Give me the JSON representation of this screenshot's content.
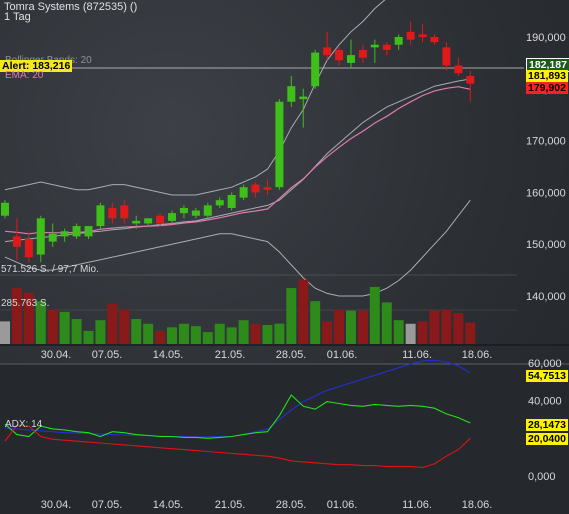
{
  "header": {
    "title": "Tomra Systems (872535) ()",
    "interval": "1 Tag",
    "bollinger_label": "Bollinger Bands: 20",
    "alert_label": "Alert: 183,216",
    "ema_label": "EMA: 20",
    "volume_max_label": "571.526 S. / 97,7 Mio.",
    "volume_mid_label": "285.763 S.",
    "adx_label": "ADX: 14"
  },
  "price_tags": {
    "last": "182,187",
    "upper": "181,893",
    "lower": "179,902"
  },
  "adx_tags": {
    "blue": "54,7513",
    "green": "28,1473",
    "red": "20,0400"
  },
  "colors": {
    "up": "#3fbf1a",
    "down": "#e01a1a",
    "volume_up": "#2f8a1c",
    "volume_down": "#8a1a1a",
    "volume_neutral": "#9a9a9a",
    "bollinger": "#a8adb3",
    "ema": "#e07ab0",
    "adx_blue": "#2330d8",
    "adx_green": "#22e01a",
    "adx_red": "#e01414",
    "alert_line": "#cfcfcf"
  },
  "chart_data": [
    {
      "type": "candlestick",
      "name": "price",
      "yticks": [
        140000,
        150000,
        160000,
        170000,
        180000,
        190000
      ],
      "ytick_labels": [
        "140,000",
        "150,000",
        "160,000",
        "170,000",
        "180,000",
        "190,000"
      ],
      "xtick_labels": [
        "30.04.",
        "07.05.",
        "14.05.",
        "21.05.",
        "28.05.",
        "01.06.",
        "11.06.",
        "18.06."
      ],
      "candles": [
        {
          "o": 155.5,
          "h": 158.5,
          "l": 155.0,
          "c": 158.0
        },
        {
          "o": 151.5,
          "h": 155.0,
          "l": 147.0,
          "c": 149.5
        },
        {
          "o": 151.0,
          "h": 152.5,
          "l": 146.5,
          "c": 147.5
        },
        {
          "o": 148.0,
          "h": 155.5,
          "l": 146.5,
          "c": 155.0
        },
        {
          "o": 150.5,
          "h": 154.0,
          "l": 149.5,
          "c": 152.0
        },
        {
          "o": 151.5,
          "h": 153.0,
          "l": 150.5,
          "c": 152.5
        },
        {
          "o": 151.5,
          "h": 154.0,
          "l": 151.0,
          "c": 153.5
        },
        {
          "o": 151.5,
          "h": 153.0,
          "l": 151.0,
          "c": 153.5
        },
        {
          "o": 153.5,
          "h": 158.0,
          "l": 153.0,
          "c": 157.5
        },
        {
          "o": 157.0,
          "h": 158.0,
          "l": 154.0,
          "c": 155.0
        },
        {
          "o": 157.5,
          "h": 158.5,
          "l": 154.0,
          "c": 155.0
        },
        {
          "o": 154.0,
          "h": 155.5,
          "l": 153.0,
          "c": 154.5
        },
        {
          "o": 154.0,
          "h": 155.0,
          "l": 153.5,
          "c": 155.0
        },
        {
          "o": 155.5,
          "h": 156.0,
          "l": 153.5,
          "c": 154.0
        },
        {
          "o": 154.5,
          "h": 156.5,
          "l": 154.0,
          "c": 156.0
        },
        {
          "o": 156.0,
          "h": 157.5,
          "l": 155.0,
          "c": 157.0
        },
        {
          "o": 155.5,
          "h": 157.0,
          "l": 155.0,
          "c": 156.5
        },
        {
          "o": 155.5,
          "h": 158.0,
          "l": 155.0,
          "c": 157.5
        },
        {
          "o": 157.5,
          "h": 159.0,
          "l": 157.0,
          "c": 158.5
        },
        {
          "o": 157.0,
          "h": 160.0,
          "l": 156.5,
          "c": 159.5
        },
        {
          "o": 159.0,
          "h": 161.5,
          "l": 158.5,
          "c": 161.0
        },
        {
          "o": 161.5,
          "h": 162.0,
          "l": 159.0,
          "c": 160.0
        },
        {
          "o": 161.0,
          "h": 162.5,
          "l": 159.5,
          "c": 160.5
        },
        {
          "o": 161.0,
          "h": 178.0,
          "l": 160.5,
          "c": 177.5
        },
        {
          "o": 177.5,
          "h": 182.5,
          "l": 176.5,
          "c": 180.5
        },
        {
          "o": 178.0,
          "h": 180.0,
          "l": 172.5,
          "c": 178.5
        },
        {
          "o": 180.5,
          "h": 187.5,
          "l": 180.0,
          "c": 187.0
        },
        {
          "o": 188.0,
          "h": 191.0,
          "l": 185.5,
          "c": 186.5
        },
        {
          "o": 187.5,
          "h": 188.0,
          "l": 184.5,
          "c": 185.5
        },
        {
          "o": 185.0,
          "h": 189.5,
          "l": 184.0,
          "c": 186.5
        },
        {
          "o": 187.5,
          "h": 188.5,
          "l": 185.0,
          "c": 186.0
        },
        {
          "o": 188.0,
          "h": 189.5,
          "l": 185.0,
          "c": 188.5
        },
        {
          "o": 188.5,
          "h": 189.0,
          "l": 186.5,
          "c": 187.5
        },
        {
          "o": 188.5,
          "h": 190.5,
          "l": 187.5,
          "c": 190.0
        },
        {
          "o": 191.0,
          "h": 193.0,
          "l": 188.5,
          "c": 189.5
        },
        {
          "o": 190.5,
          "h": 192.5,
          "l": 189.0,
          "c": 190.0
        },
        {
          "o": 190.0,
          "h": 190.5,
          "l": 188.5,
          "c": 189.0
        },
        {
          "o": 188.0,
          "h": 189.0,
          "l": 183.5,
          "c": 184.5
        },
        {
          "o": 184.5,
          "h": 186.0,
          "l": 182.5,
          "c": 183.0
        },
        {
          "o": 182.5,
          "h": 183.5,
          "l": 177.5,
          "c": 181.0
        }
      ],
      "bollinger_upper": [
        160.5,
        161.0,
        161.5,
        162.0,
        161.5,
        161.0,
        160.5,
        160.5,
        161.0,
        161.5,
        161.5,
        161.0,
        160.5,
        160.0,
        159.5,
        159.5,
        159.5,
        160.0,
        160.5,
        161.0,
        162.0,
        163.0,
        164.5,
        168.0,
        172.5,
        176.0,
        181.0,
        185.5,
        188.5,
        191.0,
        193.0,
        195.5,
        197.5,
        199.5,
        201.0,
        202.0,
        202.5,
        202.0,
        201.0,
        200.0
      ],
      "bollinger_mid": [
        150.5,
        150.8,
        151.0,
        151.3,
        151.5,
        151.8,
        152.0,
        152.3,
        152.5,
        152.8,
        153.0,
        153.3,
        153.5,
        153.8,
        154.0,
        154.3,
        154.5,
        155.0,
        155.5,
        156.0,
        156.5,
        157.0,
        157.5,
        158.5,
        160.5,
        162.5,
        165.0,
        167.5,
        169.5,
        171.5,
        173.5,
        175.0,
        176.5,
        177.5,
        178.5,
        179.5,
        180.5,
        181.0,
        181.5,
        181.9
      ],
      "bollinger_lower": [
        147.5,
        146.5,
        145.5,
        145.0,
        145.0,
        145.5,
        146.0,
        146.5,
        147.0,
        147.5,
        148.0,
        148.5,
        149.0,
        149.5,
        150.0,
        150.5,
        151.0,
        151.5,
        152.0,
        152.0,
        151.5,
        151.0,
        150.5,
        148.5,
        146.0,
        143.5,
        141.5,
        140.5,
        140.0,
        140.0,
        140.0,
        140.5,
        141.5,
        143.0,
        145.0,
        147.5,
        150.0,
        152.5,
        155.5,
        158.5
      ],
      "ema": [
        152.5,
        152.3,
        152.0,
        152.3,
        152.2,
        152.2,
        152.3,
        152.4,
        152.9,
        153.1,
        153.3,
        153.4,
        153.5,
        153.6,
        153.8,
        154.1,
        154.3,
        154.7,
        155.1,
        155.6,
        156.1,
        156.4,
        156.8,
        158.8,
        160.9,
        162.6,
        164.9,
        166.9,
        168.7,
        170.4,
        171.8,
        173.4,
        174.7,
        176.2,
        177.5,
        178.7,
        179.6,
        180.1,
        180.4,
        179.9
      ]
    },
    {
      "type": "bar",
      "name": "volume",
      "max_label": "571.526 S. / 97,7 Mio.",
      "values": [
        190000,
        470000,
        430000,
        360000,
        290000,
        270000,
        210000,
        110000,
        200000,
        340000,
        290000,
        210000,
        170000,
        110000,
        140000,
        170000,
        150000,
        100000,
        170000,
        140000,
        200000,
        170000,
        160000,
        171526,
        470000,
        540000,
        360000,
        190000,
        290000,
        280000,
        280000,
        480000,
        350000,
        200000,
        170000,
        190000,
        280000,
        290000,
        260000,
        180000
      ],
      "volume_max": 571526,
      "direction": [
        "n",
        "d",
        "d",
        "u",
        "d",
        "u",
        "u",
        "u",
        "u",
        "d",
        "d",
        "u",
        "u",
        "d",
        "u",
        "u",
        "u",
        "u",
        "u",
        "u",
        "u",
        "d",
        "u",
        "u",
        "u",
        "d",
        "u",
        "d",
        "d",
        "u",
        "d",
        "u",
        "u",
        "u",
        "n",
        "d",
        "d",
        "d",
        "d",
        "d"
      ]
    },
    {
      "type": "line",
      "name": "adx",
      "yticks": [
        0,
        20,
        40,
        60
      ],
      "ytick_labels": [
        "0,000",
        "20,000",
        "40,000",
        "60,000"
      ],
      "xtick_labels": [
        "30.04.",
        "07.05.",
        "14.05.",
        "21.05.",
        "28.05.",
        "01.06.",
        "11.06.",
        "18.06."
      ],
      "series": [
        {
          "name": "ADX",
          "color_key": "adx_blue",
          "values": [
            25.5,
            25.0,
            24.5,
            24.0,
            23.5,
            23.0,
            22.8,
            22.5,
            22.3,
            22.0,
            21.8,
            21.6,
            21.4,
            21.2,
            21.0,
            20.9,
            20.8,
            20.8,
            20.9,
            21.0,
            22.0,
            23.5,
            25.0,
            30.0,
            35.0,
            39.5,
            42.5,
            45.5,
            47.5,
            49.5,
            51.5,
            53.5,
            55.5,
            57.5,
            59.5,
            61.0,
            61.5,
            60.5,
            58.5,
            54.75
          ]
        },
        {
          "name": "+DI",
          "color_key": "adx_green",
          "values": [
            27.5,
            22.0,
            21.0,
            26.5,
            25.0,
            24.5,
            23.5,
            23.0,
            21.0,
            23.5,
            23.0,
            22.0,
            21.5,
            21.0,
            21.0,
            20.5,
            20.5,
            20.0,
            20.5,
            21.0,
            22.0,
            23.0,
            23.5,
            32.0,
            43.0,
            37.0,
            35.5,
            39.5,
            38.5,
            37.5,
            37.0,
            38.0,
            37.5,
            37.0,
            37.5,
            37.0,
            36.0,
            33.0,
            31.0,
            28.15
          ]
        },
        {
          "name": "-DI",
          "color_key": "adx_red",
          "values": [
            18.5,
            27.0,
            26.5,
            21.0,
            19.5,
            19.0,
            18.5,
            18.0,
            17.5,
            17.0,
            16.5,
            16.0,
            15.5,
            15.0,
            14.5,
            14.0,
            13.5,
            13.0,
            12.5,
            12.0,
            11.5,
            11.0,
            10.5,
            9.5,
            8.0,
            7.5,
            7.0,
            6.5,
            6.0,
            6.0,
            5.5,
            5.5,
            5.0,
            5.0,
            5.0,
            4.5,
            6.5,
            10.5,
            14.0,
            20.04
          ]
        }
      ]
    }
  ]
}
